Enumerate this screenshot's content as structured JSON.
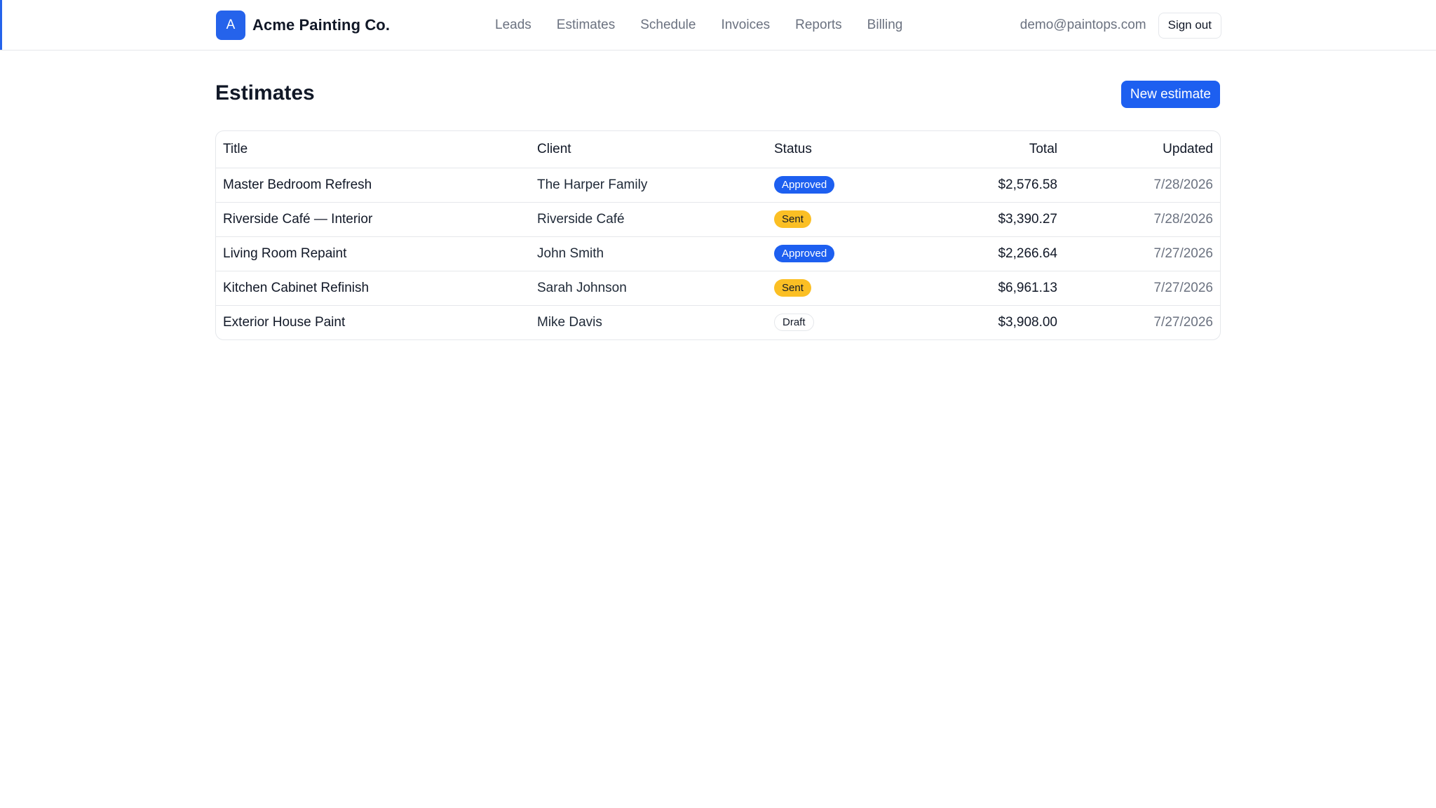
{
  "brand": {
    "logo_letter": "A",
    "name": "Acme Painting Co."
  },
  "nav": {
    "items": [
      {
        "label": "Leads"
      },
      {
        "label": "Estimates"
      },
      {
        "label": "Schedule"
      },
      {
        "label": "Invoices"
      },
      {
        "label": "Reports"
      },
      {
        "label": "Billing"
      }
    ]
  },
  "user": {
    "email": "demo@paintops.com",
    "signout_label": "Sign out"
  },
  "page": {
    "title": "Estimates",
    "new_button_label": "New estimate"
  },
  "table": {
    "columns": [
      "Title",
      "Client",
      "Status",
      "Total",
      "Updated"
    ],
    "rows": [
      {
        "title": "Master Bedroom Refresh",
        "client": "The Harper Family",
        "status": "Approved",
        "status_kind": "approved",
        "total": "$2,576.58",
        "updated": "7/28/2026"
      },
      {
        "title": "Riverside Café — Interior",
        "client": "Riverside Café",
        "status": "Sent",
        "status_kind": "sent",
        "total": "$3,390.27",
        "updated": "7/28/2026"
      },
      {
        "title": "Living Room Repaint",
        "client": "John Smith",
        "status": "Approved",
        "status_kind": "approved",
        "total": "$2,266.64",
        "updated": "7/27/2026"
      },
      {
        "title": "Kitchen Cabinet Refinish",
        "client": "Sarah Johnson",
        "status": "Sent",
        "status_kind": "sent",
        "total": "$6,961.13",
        "updated": "7/27/2026"
      },
      {
        "title": "Exterior House Paint",
        "client": "Mike Davis",
        "status": "Draft",
        "status_kind": "draft",
        "total": "$3,908.00",
        "updated": "7/27/2026"
      }
    ]
  },
  "colors": {
    "accent": "#1d5ff0",
    "approved_badge": "#1d5ff0",
    "sent_badge": "#fbbf24",
    "draft_badge_border": "#e5e7eb"
  }
}
